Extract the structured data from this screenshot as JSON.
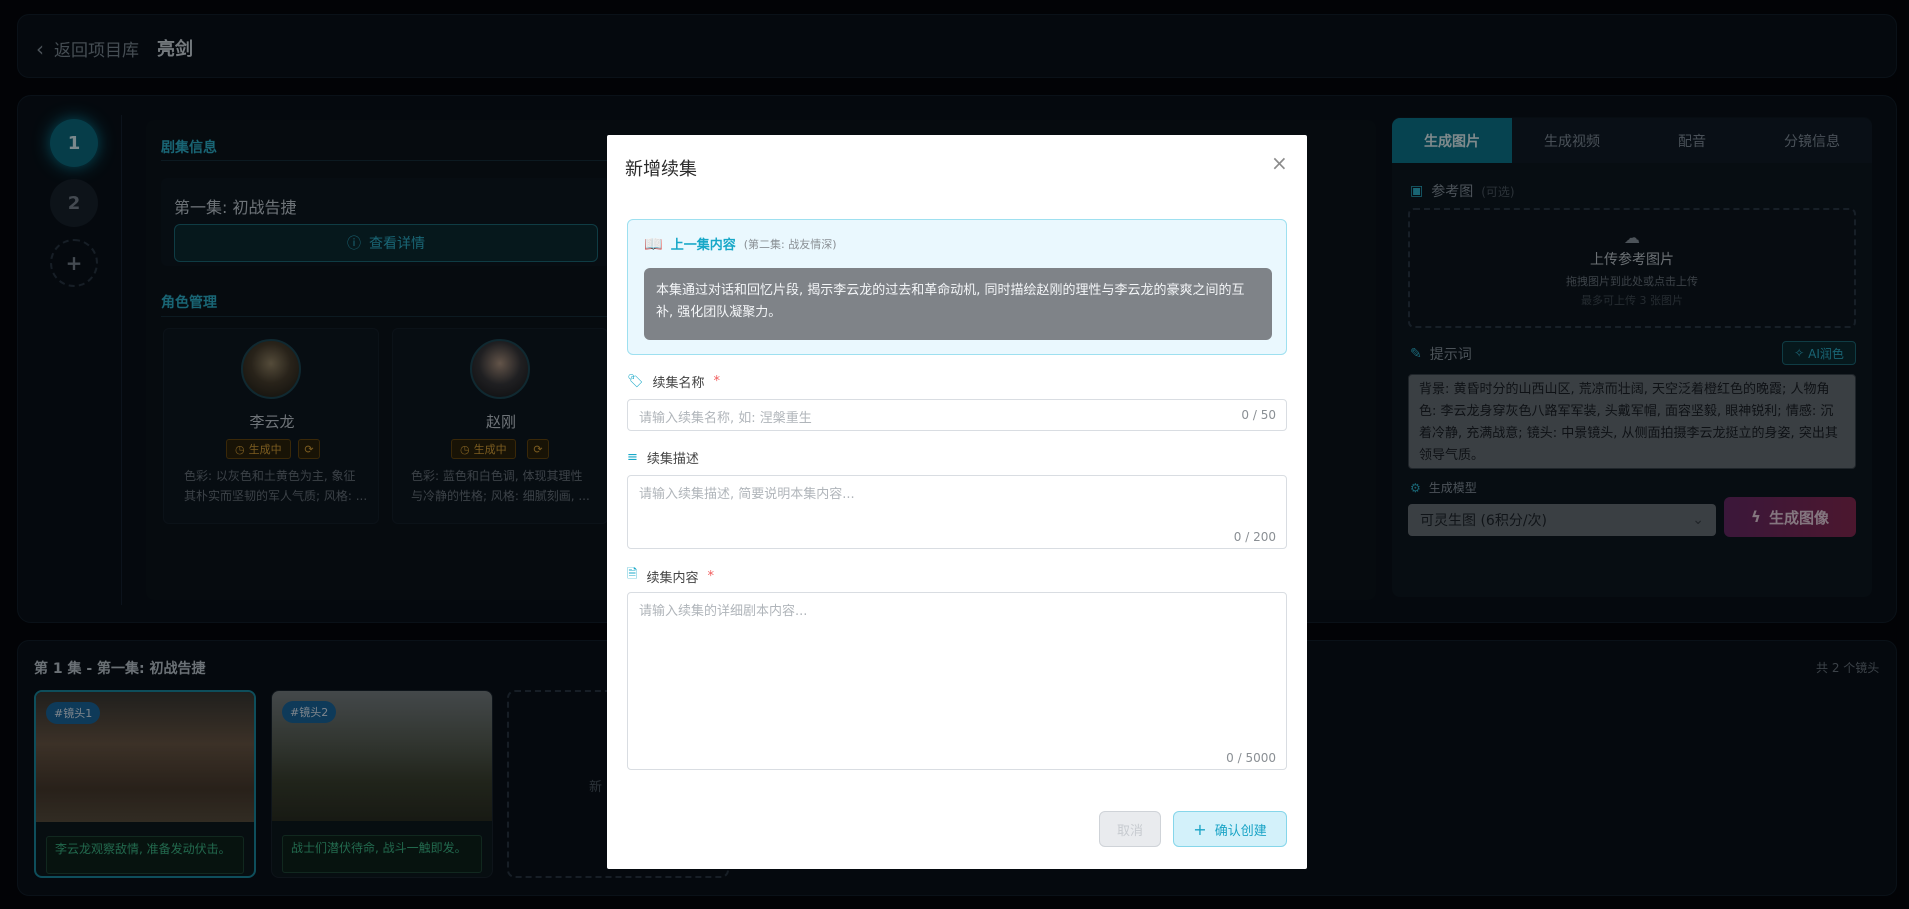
{
  "header": {
    "back_label": "返回项目库",
    "project_name": "亮剑"
  },
  "steps": {
    "step1": "1",
    "step2": "2",
    "add": "+"
  },
  "episode_info": {
    "section_title": "剧集信息",
    "episode_title": "第一集: 初战告捷",
    "detail_button": "查看详情"
  },
  "characters": {
    "section_title": "角色管理",
    "items": [
      {
        "name": "李云龙",
        "status": "生成中",
        "desc_line1": "色彩: 以灰色和土黄色为主, 象征",
        "desc_line2": "其朴实而坚韧的军人气质; 风格: ..."
      },
      {
        "name": "赵刚",
        "status": "生成中",
        "desc_line1": "色彩: 蓝色和白色调, 体现其理性",
        "desc_line2": "与冷静的性格; 风格: 细腻刻画, ..."
      }
    ]
  },
  "right_panel": {
    "tabs": [
      "生成图片",
      "生成视频",
      "配音",
      "分镜信息"
    ],
    "active_tab": 0,
    "ref_label": "参考图",
    "ref_optional": "(可选)",
    "upload_title": "上传参考图片",
    "upload_hint": "拖拽图片到此处或点击上传",
    "upload_limit": "最多可上传 3 张图片",
    "prompt_label": "提示词",
    "ai_button": "AI润色",
    "prompt_text": "背景: 黄昏时分的山西山区, 荒凉而壮阔, 天空泛着橙红色的晚霞; 人物角色: 李云龙身穿灰色八路军军装, 头戴军帽, 面容坚毅, 眼神锐利; 情感: 沉着冷静, 充满战意; 镜头: 中景镜头, 从侧面拍摄李云龙挺立的身姿, 突出其领导气质。",
    "model_label": "生成模型",
    "model_value": "可灵生图 (6积分/次)",
    "generate_button": "生成图像"
  },
  "storyboard": {
    "title": "第 1 集 - 第一集: 初战告捷",
    "count": "共 2 个镜头",
    "shots": [
      {
        "tag": "#镜头1",
        "caption": "李云龙观察敌情, 准备发动伏击。"
      },
      {
        "tag": "#镜头2",
        "caption": "战士们潜伏待命, 战斗一触即发。"
      }
    ],
    "add_label": "新"
  },
  "modal": {
    "title": "新增续集",
    "prev_title": "上一集内容",
    "prev_subtitle": "(第二集: 战友情深)",
    "prev_text": "本集通过对话和回忆片段, 揭示李云龙的过去和革命动机, 同时描绘赵刚的理性与李云龙的豪爽之间的互补, 强化团队凝聚力。",
    "name_label": "续集名称",
    "name_placeholder": "请输入续集名称, 如: 涅槃重生",
    "name_count": "0 / 50",
    "desc_label": "续集描述",
    "desc_placeholder": "请输入续集描述, 简要说明本集内容...",
    "desc_count": "0 / 200",
    "content_label": "续集内容",
    "content_placeholder": "请输入续集的详细剧本内容...",
    "content_count": "0 / 5000",
    "required_mark": "*",
    "cancel_button": "取消",
    "confirm_button": "确认创建"
  }
}
